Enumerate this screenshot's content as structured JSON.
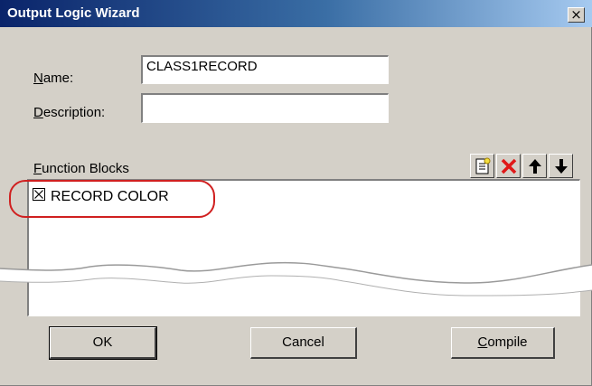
{
  "window": {
    "title": "Output Logic Wizard",
    "close_label": "×"
  },
  "form": {
    "name_label": "ame:",
    "name_mnemonic": "N",
    "name_value": "CLASS1RECORD",
    "description_label": "escription:",
    "description_mnemonic": "D",
    "description_value": ""
  },
  "function_blocks": {
    "label": "unction Blocks",
    "label_mnemonic": "F",
    "toolbar": [
      "add-icon",
      "delete-icon",
      "move-up-icon",
      "move-down-icon"
    ],
    "items": [
      {
        "label": "RECORD COLOR",
        "checked": true
      }
    ]
  },
  "buttons": {
    "ok": "OK",
    "cancel": "Cancel",
    "compile_mnemonic": "C",
    "compile_rest": "ompile"
  },
  "colors": {
    "title_bar_start": "#0a246a",
    "dialog_bg": "#d4d0c8",
    "highlight": "#d02020"
  }
}
